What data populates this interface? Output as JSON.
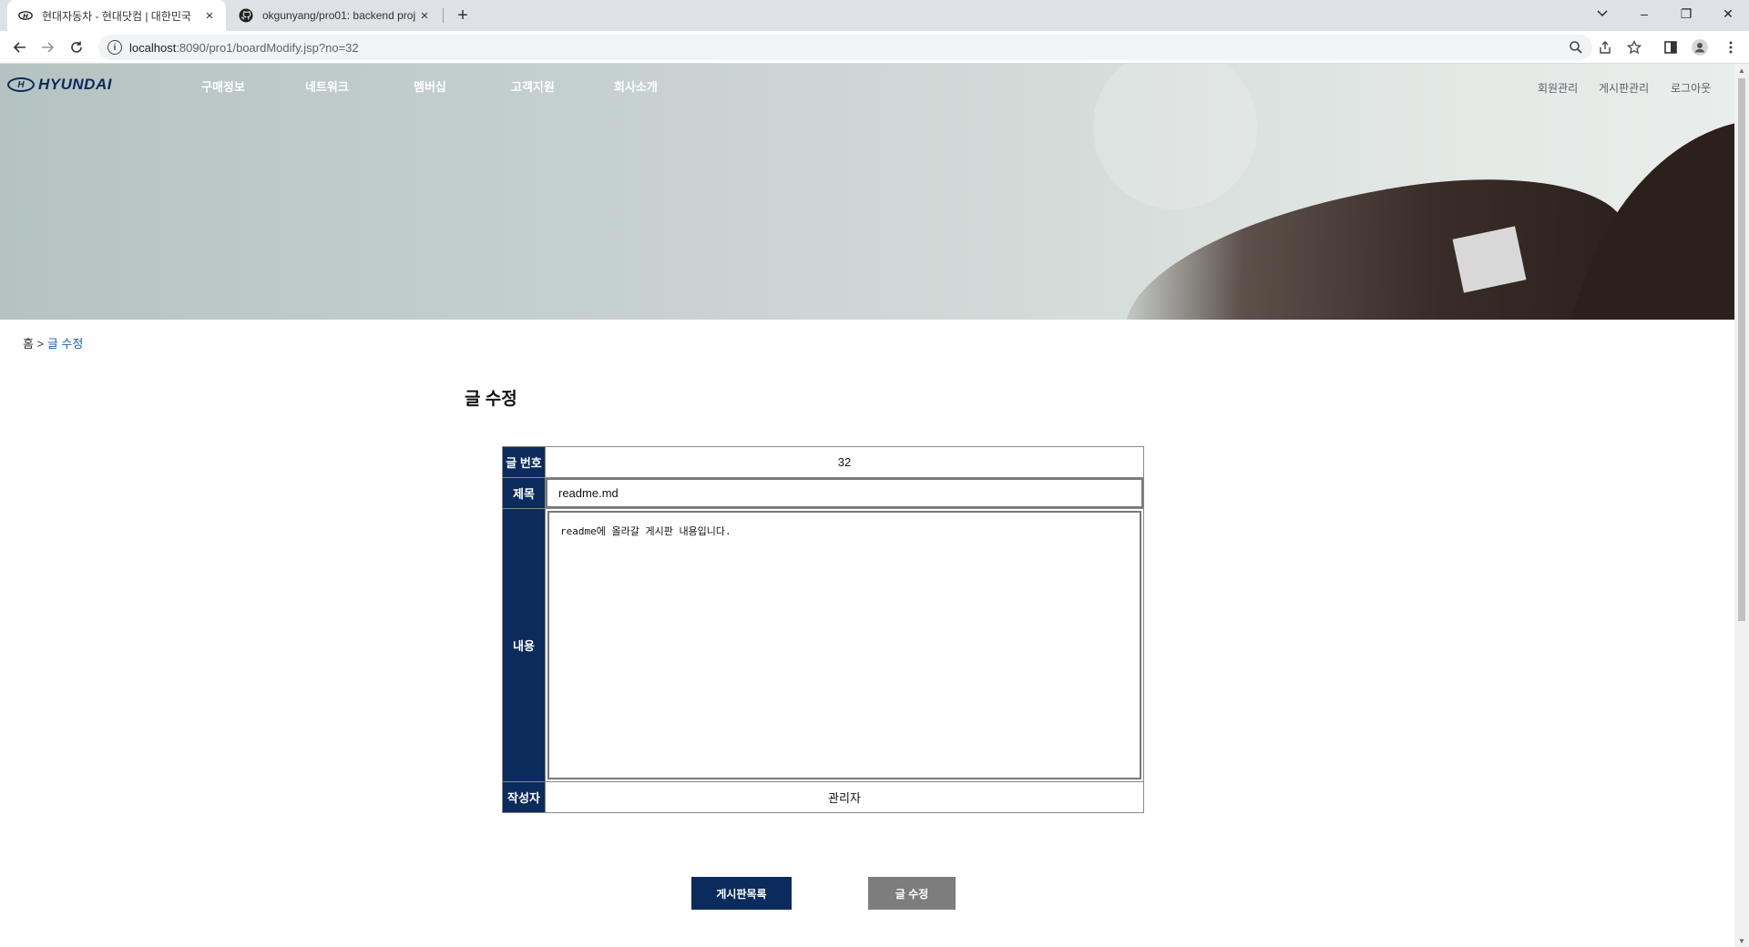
{
  "browser": {
    "tabs": [
      {
        "title": "현대자동차 - 현대닷컴 | 대한민국",
        "favicon": "hyundai-icon",
        "close": "×"
      },
      {
        "title": "okgunyang/pro01: backend proj",
        "favicon": "github-icon",
        "close": "×"
      }
    ],
    "new_tab": "+",
    "url_host": "localhost",
    "url_rest": ":8090/pro1/boardModify.jsp?no=32",
    "window_controls": {
      "minimize": "–",
      "restore": "❐",
      "close": "✕"
    }
  },
  "site": {
    "logo_text": "HYUNDAI",
    "logo_emblem": "H",
    "gnb": [
      "구매정보",
      "네트워크",
      "멤버십",
      "고객지원",
      "회사소개"
    ],
    "util": [
      "회원관리",
      "게시판관리",
      "로그아웃"
    ]
  },
  "breadcrumb": {
    "home": "홈",
    "sep": ">",
    "current": "글 수정"
  },
  "page_title": "글 수정",
  "form": {
    "no_label": "글 번호",
    "no_value": "32",
    "title_label": "제목",
    "title_value": "readme.md",
    "content_label": "내용",
    "content_value": "readme에 올라갈 게시판 내용입니다.",
    "author_label": "작성자",
    "author_value": "관리자"
  },
  "buttons": {
    "list": "게시판목록",
    "modify": "글 수정"
  },
  "colors": {
    "primary": "#0b2b5c",
    "secondary": "#7d7d7d",
    "link": "#1a5fb4"
  }
}
